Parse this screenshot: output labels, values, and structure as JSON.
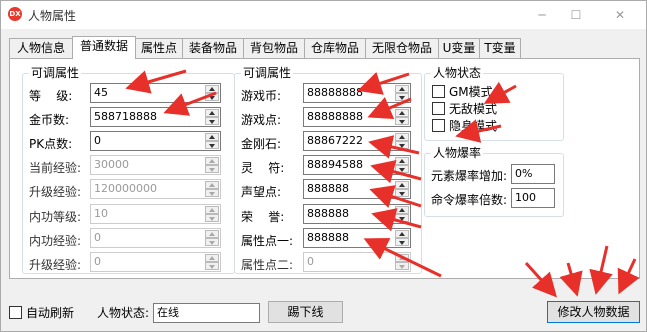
{
  "window": {
    "title": "人物属性",
    "icon_text": "DX",
    "minimize_glyph": "─",
    "maximize_glyph": "☐",
    "close_glyph": "✕"
  },
  "tabs": [
    {
      "label": "人物信息",
      "active": false
    },
    {
      "label": "普通数据",
      "active": true
    },
    {
      "label": "属性点",
      "active": false
    },
    {
      "label": "装备物品",
      "active": false
    },
    {
      "label": "背包物品",
      "active": false
    },
    {
      "label": "仓库物品",
      "active": false
    },
    {
      "label": "无限仓物品",
      "active": false
    },
    {
      "label": "U变量",
      "active": false
    },
    {
      "label": "T变量",
      "active": false
    }
  ],
  "left_group": {
    "title": "可调属性",
    "rows": [
      {
        "label": "等    级:",
        "value": "45",
        "enabled": true
      },
      {
        "label": "金币数:",
        "value": "588718888",
        "enabled": true
      },
      {
        "label": "PK点数:",
        "value": "0",
        "enabled": true
      },
      {
        "label": "当前经验:",
        "value": "30000",
        "enabled": false
      },
      {
        "label": "升级经验:",
        "value": "120000000",
        "enabled": false
      },
      {
        "label": "内功等级:",
        "value": "10",
        "enabled": false
      },
      {
        "label": "内功经验:",
        "value": "0",
        "enabled": false
      },
      {
        "label": "升级经验:",
        "value": "0",
        "enabled": false
      }
    ]
  },
  "mid_group": {
    "title": "可调属性",
    "rows": [
      {
        "label": "游戏币:",
        "value": "88888888",
        "enabled": true
      },
      {
        "label": "游戏点:",
        "value": "88888888",
        "enabled": true
      },
      {
        "label": "金刚石:",
        "value": "88867222",
        "enabled": true
      },
      {
        "label": "灵    符:",
        "value": "88894588",
        "enabled": true
      },
      {
        "label": "声望点:",
        "value": "888888",
        "enabled": true
      },
      {
        "label": "荣    誉:",
        "value": "888888",
        "enabled": true
      },
      {
        "label": "属性点一:",
        "value": "888888",
        "enabled": true
      },
      {
        "label": "属性点二:",
        "value": "0",
        "enabled": false
      }
    ]
  },
  "status_group": {
    "title": "人物状态",
    "checkboxes": [
      {
        "label": "GM模式",
        "checked": false
      },
      {
        "label": "无敌模式",
        "checked": false
      },
      {
        "label": "隐身模式",
        "checked": false
      }
    ]
  },
  "drop_group": {
    "title": "人物爆率",
    "rows": [
      {
        "label": "元素爆率增加:",
        "value": "0%"
      },
      {
        "label": "命令爆率倍数:",
        "value": "100"
      }
    ]
  },
  "bottom": {
    "auto_refresh_label": "自动刷新",
    "auto_refresh_checked": false,
    "status_label": "人物状态:",
    "status_value": "在线",
    "kick_button": "踢下线",
    "modify_button": "修改人物数据"
  },
  "colors": {
    "annotation_arrow": "#e8302a",
    "primary_button_border": "#0078d7"
  }
}
